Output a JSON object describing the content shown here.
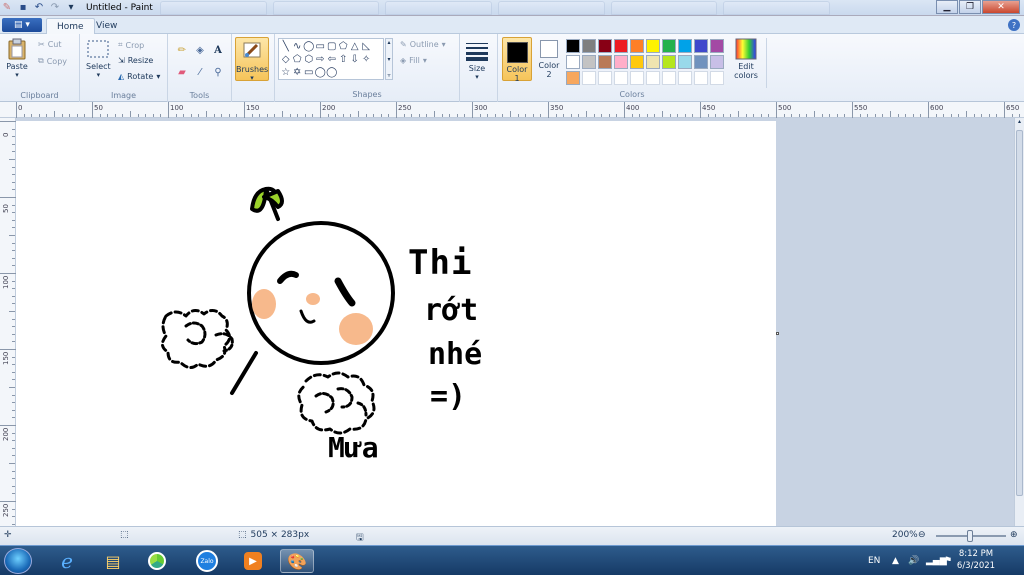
{
  "window": {
    "title": "Untitled - Paint"
  },
  "tabs": {
    "file": "▤ ▾",
    "home": "Home",
    "view": "View"
  },
  "clipboard": {
    "paste": "Paste",
    "cut": "Cut",
    "copy": "Copy",
    "label": "Clipboard"
  },
  "image": {
    "select": "Select",
    "crop": "Crop",
    "resize": "Resize",
    "rotate": "Rotate",
    "label": "Image"
  },
  "tools": {
    "label": "Tools"
  },
  "brushes": {
    "label": "Brushes"
  },
  "shapes": {
    "outline": "Outline",
    "fill": "Fill",
    "label": "Shapes"
  },
  "size": {
    "label": "Size"
  },
  "colors": {
    "color1": "Color\n1",
    "color1_line1": "Color",
    "color1_line2": "1",
    "color2_line1": "Color",
    "color2_line2": "2",
    "edit_line1": "Edit",
    "edit_line2": "colors",
    "label": "Colors",
    "color1_value": "#000000",
    "color2_value": "#ffffff",
    "palette": [
      "#000000",
      "#7f7f7f",
      "#880015",
      "#ed1c24",
      "#ff7f27",
      "#fff200",
      "#22b14c",
      "#00a2e8",
      "#3f48cc",
      "#a349a4",
      "#ffffff",
      "#c3c3c3",
      "#b97a57",
      "#ffaec9",
      "#ffc90e",
      "#efe4b0",
      "#b5e61d",
      "#99d9ea",
      "#7092be",
      "#c8bfe7",
      "#f7a75e",
      "#ffffff",
      "#ffffff",
      "#ffffff",
      "#ffffff",
      "#ffffff",
      "#ffffff",
      "#ffffff",
      "#ffffff",
      "#ffffff"
    ]
  },
  "ruler": {
    "h": [
      "0",
      "50",
      "100",
      "150",
      "200",
      "250",
      "300",
      "350",
      "400",
      "450",
      "500",
      "550",
      "600",
      "650"
    ],
    "v": [
      "0",
      "50",
      "100",
      "150",
      "200",
      "250"
    ]
  },
  "drawing": {
    "text1": "Thi",
    "text2": "rớt",
    "text3": "nhé",
    "text4": "=)",
    "text5": "Mưa"
  },
  "status": {
    "image_size": "505 × 283px",
    "zoom": "200%"
  },
  "taskbar": {
    "lang": "EN",
    "time": "8:12 PM",
    "date": "6/3/2021",
    "zalo": "Zalo"
  }
}
